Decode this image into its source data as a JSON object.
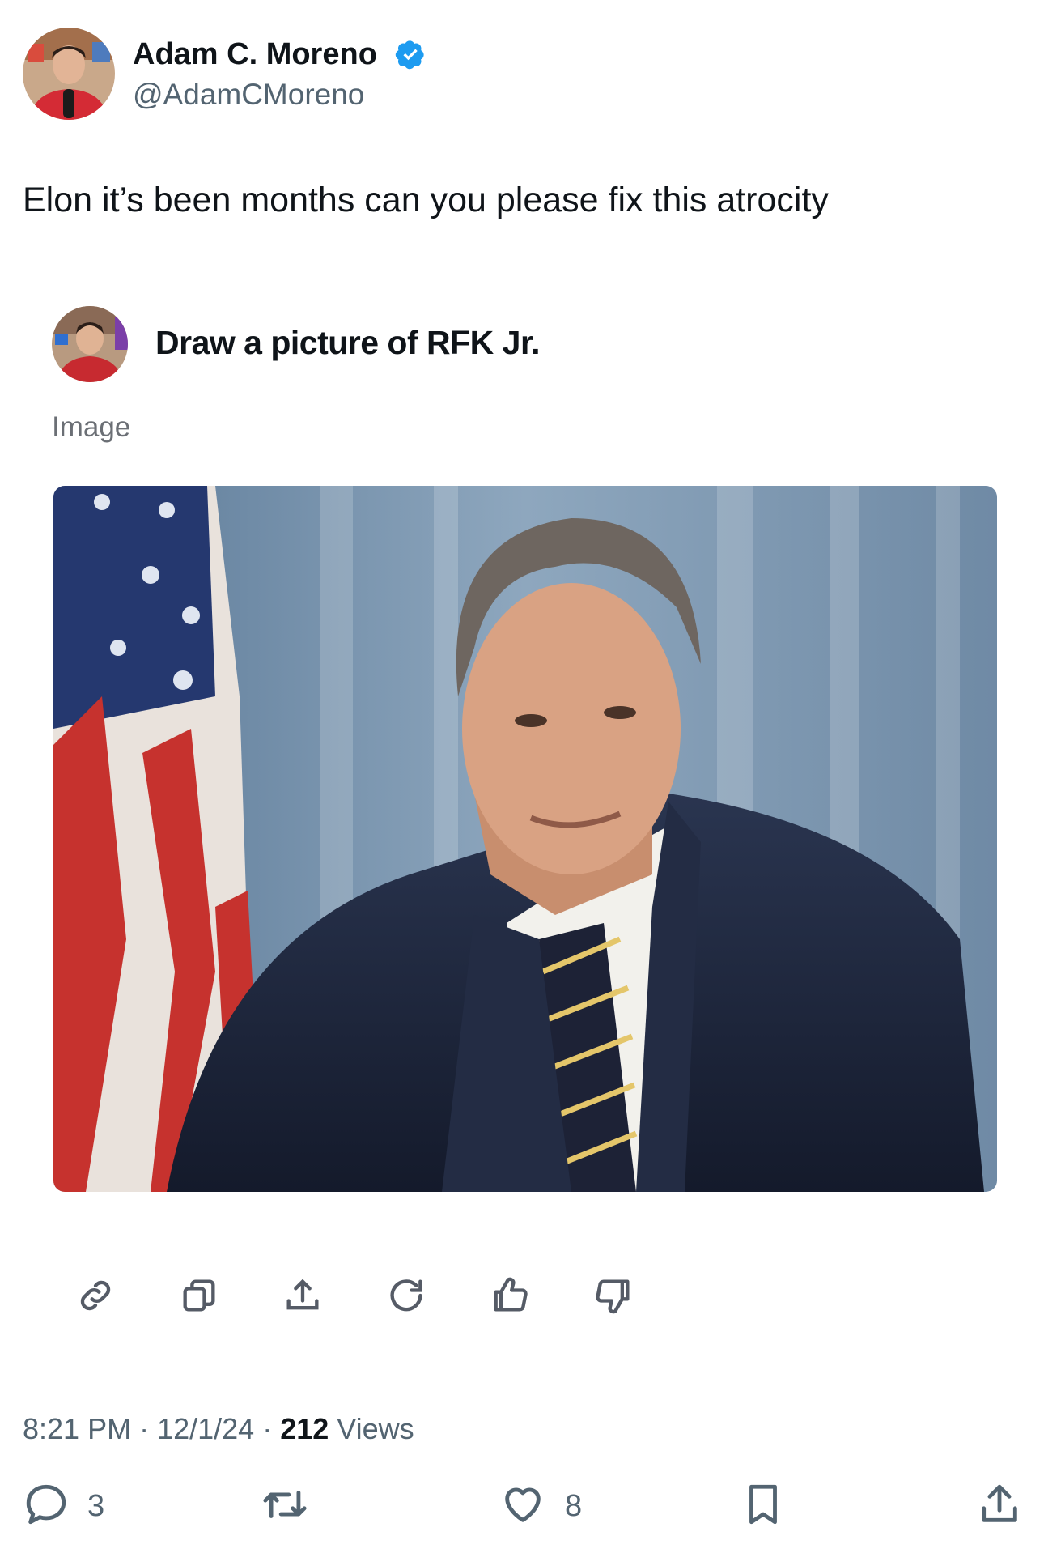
{
  "tweet": {
    "author": {
      "display_name": "Adam C. Moreno",
      "handle": "@AdamCMoreno",
      "verified_color": "#1d9bf0"
    },
    "text": "Elon it’s been months can you please fix this atrocity",
    "embedded_chat": {
      "prompt": "Draw a picture of RFK Jr.",
      "response_label": "Image",
      "actions": [
        "link-icon",
        "copy-icon",
        "share-icon",
        "regenerate-icon",
        "thumbs-up-icon",
        "thumbs-down-icon"
      ]
    },
    "meta": {
      "time": "8:21 PM",
      "sep1": " · ",
      "date": "12/1/24",
      "sep2": " · ",
      "views_count": "212",
      "views_label": " Views"
    },
    "stats": {
      "replies": "3",
      "likes": "8"
    },
    "icons": [
      "reply-icon",
      "retweet-icon",
      "like-icon",
      "bookmark-icon",
      "share-icon"
    ]
  }
}
